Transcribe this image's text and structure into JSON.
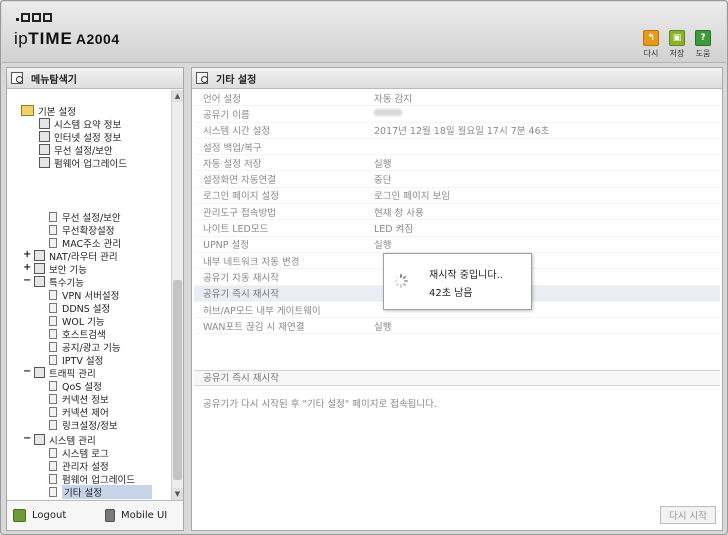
{
  "header": {
    "brand_prefix": "ip",
    "brand_bold": "TIME",
    "model": "A2004",
    "buttons": [
      {
        "label": "다시",
        "icon": "refresh-icon",
        "color": "#e49b1d"
      },
      {
        "label": "저장",
        "icon": "save-icon",
        "color": "#8ab529"
      },
      {
        "label": "도움",
        "icon": "help-icon",
        "color": "#3f9b3a",
        "glyph": "?"
      }
    ]
  },
  "left_panel": {
    "title": "메뉴탐색기",
    "tree_top": [
      {
        "label": "기본 설정",
        "kind": "folder"
      },
      {
        "label": "시스템 요약 정보",
        "kind": "item"
      },
      {
        "label": "인터넷 설정 정보",
        "kind": "item"
      },
      {
        "label": "무선 설정/보안",
        "kind": "item"
      },
      {
        "label": "펌웨어 업그레이드",
        "kind": "item"
      }
    ],
    "tree_bottom": [
      {
        "label": "무선 설정/보안",
        "kind": "leaf"
      },
      {
        "label": "무선확장설정",
        "kind": "leaf"
      },
      {
        "label": "MAC주소 관리",
        "kind": "leaf"
      },
      {
        "label": "NAT/라우터 관리",
        "kind": "group",
        "toggle": "+"
      },
      {
        "label": "보안 기능",
        "kind": "group",
        "toggle": "+"
      },
      {
        "label": "특수기능",
        "kind": "group",
        "toggle": "−"
      },
      {
        "label": "VPN 서버설정",
        "kind": "leaf"
      },
      {
        "label": "DDNS 설정",
        "kind": "leaf"
      },
      {
        "label": "WOL 기능",
        "kind": "leaf"
      },
      {
        "label": "호스트검색",
        "kind": "leaf"
      },
      {
        "label": "공지/광고 기능",
        "kind": "leaf"
      },
      {
        "label": "IPTV 설정",
        "kind": "leaf"
      },
      {
        "label": "트래픽 관리",
        "kind": "group",
        "toggle": "−"
      },
      {
        "label": "QoS 설정",
        "kind": "leaf"
      },
      {
        "label": "커넥션 정보",
        "kind": "leaf"
      },
      {
        "label": "커넥션 제어",
        "kind": "leaf"
      },
      {
        "label": "링크설정/정보",
        "kind": "leaf"
      },
      {
        "label": "시스템 관리",
        "kind": "group",
        "toggle": "−"
      },
      {
        "label": "시스템 로그",
        "kind": "leaf"
      },
      {
        "label": "관리자 설정",
        "kind": "leaf"
      },
      {
        "label": "펌웨어 업그레이드",
        "kind": "leaf"
      },
      {
        "label": "기타 설정",
        "kind": "leaf",
        "selected": true
      }
    ],
    "footer": {
      "logout": "Logout",
      "mobile": "Mobile UI"
    }
  },
  "right_panel": {
    "title": "기타 설정",
    "settings": [
      {
        "key": "언어 설정",
        "value": "자동 감지"
      },
      {
        "key": "공유기 이름",
        "value": ""
      },
      {
        "key": "시스템 시간 설정",
        "value": "2017년 12월 18일 월요일 17시 7분 46초"
      },
      {
        "key": "설정 백업/복구",
        "value": ""
      },
      {
        "key": "자동 설정 저장",
        "value": "실행"
      },
      {
        "key": "설정화면 자동연결",
        "value": "중단"
      },
      {
        "key": "로그인 페이지 설정",
        "value": "로그인 페이지 보임"
      },
      {
        "key": "관리도구 접속방법",
        "value": "현재 창 사용"
      },
      {
        "key": "나이트 LED모드",
        "value": "LED 켜짐"
      },
      {
        "key": "UPNP 설정",
        "value": "실행"
      },
      {
        "key": "내부 네트워크 자동 변경",
        "value": ""
      },
      {
        "key": "공유기 자동 재시작",
        "value": ""
      },
      {
        "key": "공유기 즉시 재시작",
        "value": "",
        "highlight": true
      },
      {
        "key": "허브/AP모드 내부 게이트웨이",
        "value": ""
      },
      {
        "key": "WAN포트 끊김 시 재연결",
        "value": "실행"
      }
    ],
    "section_title": "공유기 즉시 재시작",
    "section_desc": "공유기가 다시 시작된 후 \"기타 설정\" 페이지로 접속됩니다.",
    "restart_button": "다시 시작"
  },
  "dialog": {
    "line1": "재시작 중입니다..",
    "line2": "42초 남음"
  }
}
